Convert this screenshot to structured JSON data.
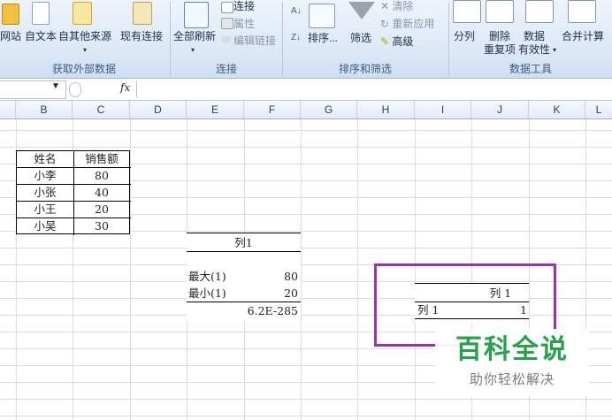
{
  "ribbon": {
    "get_external_data": {
      "buttons": [
        "网站",
        "自文本",
        "自其他来源",
        "现有连接"
      ],
      "label": "获取外部数据"
    },
    "connections": {
      "refresh_all": "全部刷新",
      "connections": "连接",
      "properties": "属性",
      "edit_links": "编辑链接",
      "label": "连接"
    },
    "sort_filter": {
      "sort": "排序...",
      "filter": "筛选",
      "clear": "清除",
      "reapply": "重新应用",
      "advanced": "高级",
      "label": "排序和筛选"
    },
    "data_tools": {
      "split": "分列",
      "remove_dup": "删除\n重复项",
      "validation": "数据\n有效性",
      "consolidate": "合并计算",
      "label": "数据工具"
    }
  },
  "formula_bar": {
    "fx": "fx"
  },
  "columns": [
    "B",
    "C",
    "D",
    "E",
    "F",
    "G",
    "H",
    "I",
    "J",
    "K",
    "L"
  ],
  "table1": {
    "headers": [
      "姓名",
      "销售额"
    ],
    "rows": [
      [
        "小李",
        "80"
      ],
      [
        "小张",
        "40"
      ],
      [
        "小王",
        "20"
      ],
      [
        "小吴",
        "30"
      ]
    ]
  },
  "stats": {
    "header": "列1",
    "max_label": "最大(1)",
    "max_value": "80",
    "min_label": "最小(1)",
    "min_value": "20",
    "extra": "6.2E-285"
  },
  "corr": {
    "header": "列 1",
    "row_label": "列 1",
    "row_value": "1"
  },
  "watermark": {
    "title": "百科全说",
    "subtitle": "助你轻松解决"
  },
  "colors": {
    "highlight_box": "#9b30b8",
    "watermark_title": "#27a24a"
  }
}
